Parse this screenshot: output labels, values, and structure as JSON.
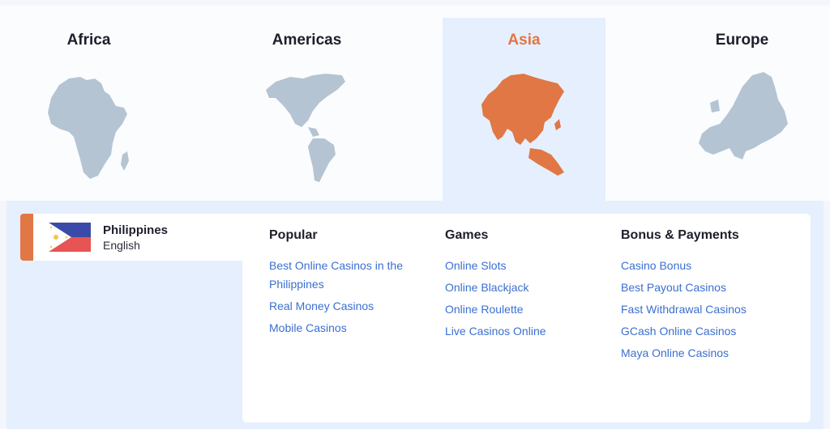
{
  "regions": [
    {
      "label": "Africa",
      "active": false
    },
    {
      "label": "Americas",
      "active": false
    },
    {
      "label": "Asia",
      "active": true
    },
    {
      "label": "Europe",
      "active": false
    }
  ],
  "colors": {
    "accent": "#e07744",
    "map_inactive": "#b5c4d3",
    "link": "#3b6fd0",
    "panel_bg": "#e6effd"
  },
  "country": {
    "name": "Philippines",
    "language": "English",
    "flag_icon": "philippines-flag-icon"
  },
  "columns": [
    {
      "heading": "Popular",
      "links": [
        "Best Online Casinos in the Philippines",
        "Real Money Casinos",
        "Mobile Casinos"
      ]
    },
    {
      "heading": "Games",
      "links": [
        "Online Slots",
        "Online Blackjack",
        "Online Roulette",
        "Live Casinos Online"
      ]
    },
    {
      "heading": "Bonus & Payments",
      "links": [
        "Casino Bonus",
        "Best Payout Casinos",
        "Fast Withdrawal Casinos",
        "GCash Online Casinos",
        "Maya Online Casinos"
      ]
    }
  ]
}
